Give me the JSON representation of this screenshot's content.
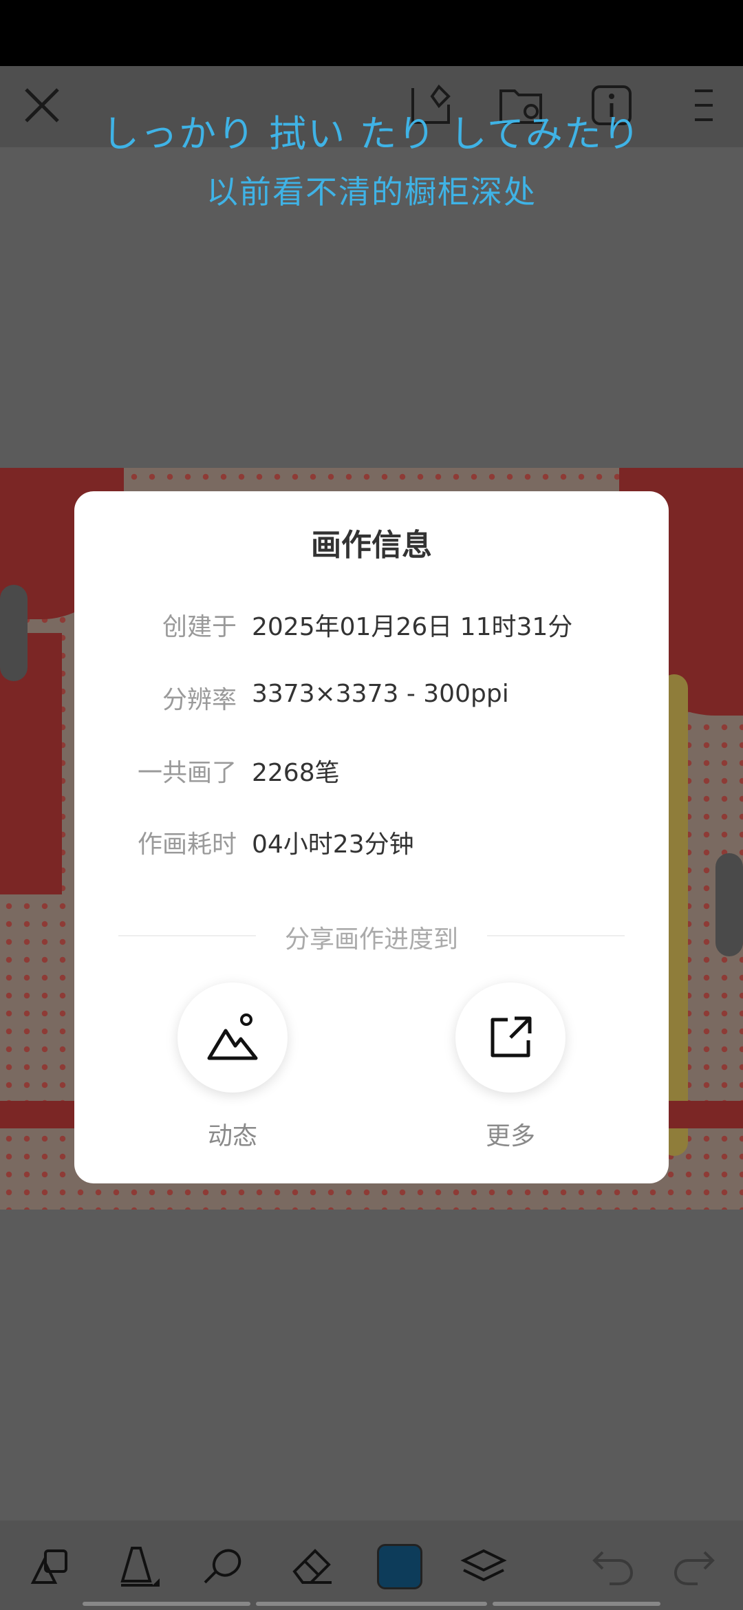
{
  "lyrics": {
    "line1": "しっかり 拭い たり してみたり",
    "line2": "以前看不清的橱柜深处"
  },
  "top_toolbar": {
    "icons": [
      "close-icon",
      "layers-shape-icon",
      "folder-icon",
      "info-icon",
      "menu-icon"
    ]
  },
  "dialog": {
    "title": "画作信息",
    "rows": [
      {
        "label": "创建于",
        "value": "2025年01月26日 11时31分"
      },
      {
        "label": "分辨率",
        "value": "3373×3373 - 300ppi"
      },
      {
        "label": "一共画了",
        "value": "2268笔"
      },
      {
        "label": "作画耗时",
        "value": "04小时23分钟"
      }
    ],
    "share_heading": "分享画作进度到",
    "share_options": [
      {
        "label": "动态",
        "icon": "mountain-image-icon"
      },
      {
        "label": "更多",
        "icon": "external-share-icon"
      }
    ]
  },
  "bottom_toolbar": {
    "icons": [
      "shapes-icon",
      "brush-icon",
      "smudge-icon",
      "eraser-icon",
      "color-swatch",
      "layers-icon",
      "undo-icon",
      "redo-icon"
    ],
    "current_color": "#0d3c5a"
  }
}
